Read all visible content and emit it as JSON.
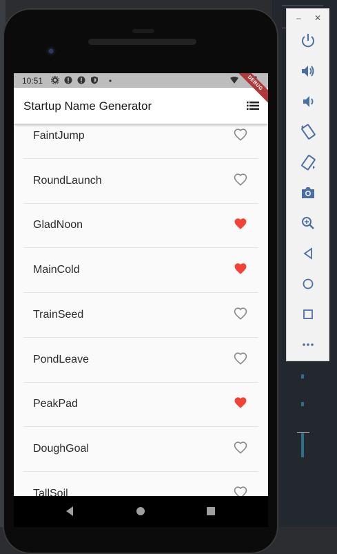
{
  "status_bar": {
    "time": "10:51"
  },
  "app_bar": {
    "title": "Startup Name Generator"
  },
  "debug_banner": "DEBUG",
  "words": [
    {
      "name": "FaintJump",
      "saved": false
    },
    {
      "name": "RoundLaunch",
      "saved": false
    },
    {
      "name": "GladNoon",
      "saved": true
    },
    {
      "name": "MainCold",
      "saved": true
    },
    {
      "name": "TrainSeed",
      "saved": false
    },
    {
      "name": "PondLeave",
      "saved": false
    },
    {
      "name": "PeakPad",
      "saved": true
    },
    {
      "name": "DoughGoal",
      "saved": false
    },
    {
      "name": "TallSoil",
      "saved": false
    }
  ],
  "colors": {
    "saved_heart": "#f44336",
    "unsaved_heart": "#8a8a8a",
    "status_bar": "#bdbdbd"
  },
  "emulator_panel": {
    "window_controls": [
      "minimize-icon",
      "close-icon"
    ],
    "buttons": [
      "power-icon",
      "volume-up-icon",
      "volume-down-icon",
      "rotate-left-icon",
      "rotate-right-icon",
      "camera-icon",
      "zoom-icon",
      "back-icon",
      "home-icon",
      "overview-icon",
      "more-icon"
    ]
  }
}
